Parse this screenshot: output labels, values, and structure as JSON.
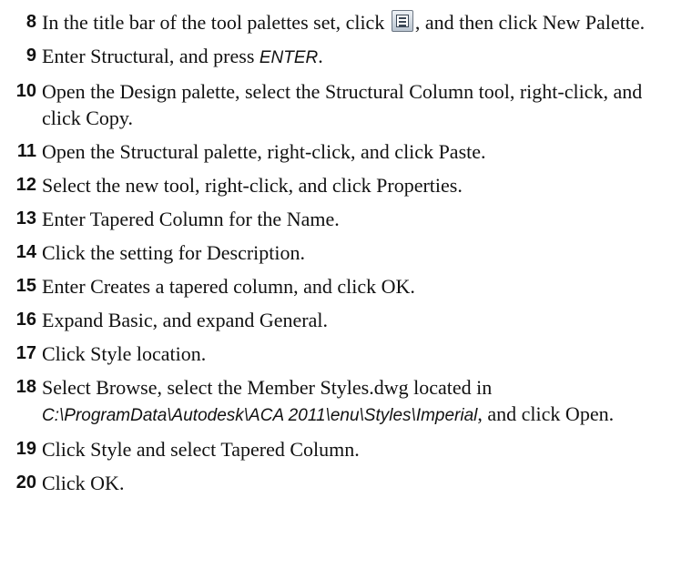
{
  "steps": [
    {
      "number": "8",
      "text_before": "In the title bar of the tool palettes set, click",
      "icon": "tool-palette-properties-icon",
      "text_after": ", and then click New Palette."
    },
    {
      "number": "9",
      "text": "Enter Structural, and press",
      "key": "ENTER",
      "text_after": "."
    },
    {
      "number": "10",
      "text": "Open the Design palette, select the Structural Column tool, right-click, and click Copy."
    },
    {
      "number": "11",
      "text": "Open the Structural palette, right-click, and click Paste."
    },
    {
      "number": "12",
      "text": "Select the new tool, right-click, and click Properties."
    },
    {
      "number": "13",
      "text": "Enter Tapered Column for the Name."
    },
    {
      "number": "14",
      "text": "Click the setting for Description."
    },
    {
      "number": "15",
      "text": "Enter Creates a tapered column, and click OK."
    },
    {
      "number": "16",
      "text": "Expand Basic, and expand General."
    },
    {
      "number": "17",
      "text": "Click Style location."
    },
    {
      "number": "18",
      "text_before": "Select Browse, select the Member Styles.dwg located in",
      "path": "C:\\ProgramData\\Autodesk\\ACA 2011\\enu\\Styles\\Imperial",
      "text_after": ", and click Open."
    },
    {
      "number": "19",
      "text": "Click Style and select Tapered Column."
    },
    {
      "number": "20",
      "text": "Click OK."
    }
  ]
}
